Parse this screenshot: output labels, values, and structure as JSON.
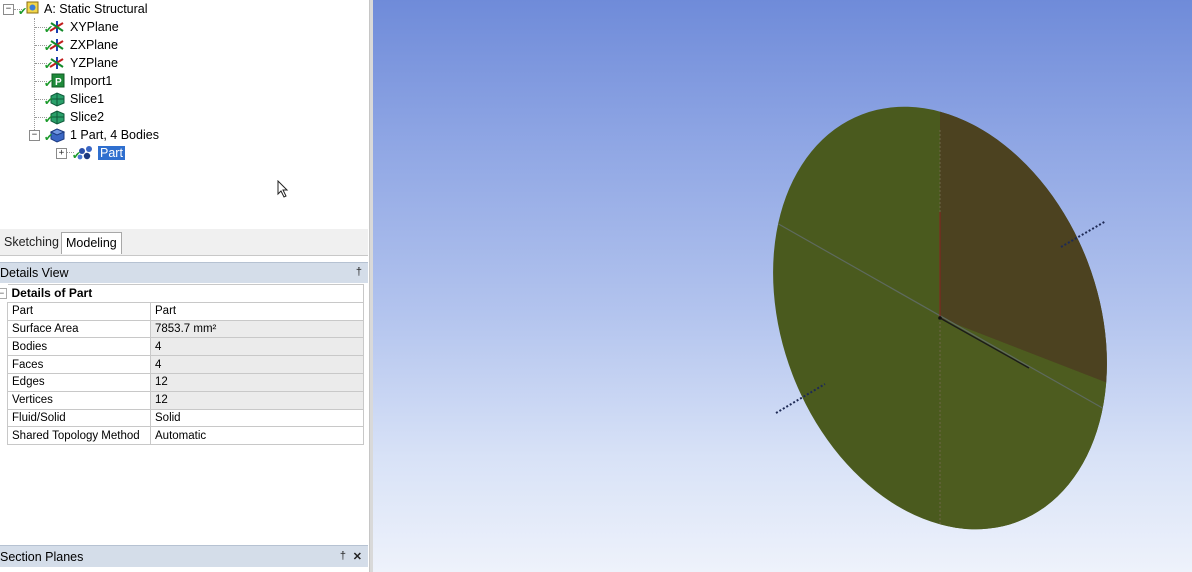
{
  "tree": {
    "root": {
      "label": "A: Static Structural",
      "icon": "static-structural-icon"
    },
    "items": [
      {
        "label": "XYPlane",
        "icon": "plane-axes-icon"
      },
      {
        "label": "ZXPlane",
        "icon": "plane-axes-icon"
      },
      {
        "label": "YZPlane",
        "icon": "plane-axes-icon"
      },
      {
        "label": "Import1",
        "icon": "import-icon"
      },
      {
        "label": "Slice1",
        "icon": "slice-icon"
      },
      {
        "label": "Slice2",
        "icon": "slice-icon"
      },
      {
        "label": "1 Part, 4 Bodies",
        "icon": "parts-bodies-icon"
      }
    ],
    "child": {
      "label": "Part",
      "icon": "multibody-part-icon",
      "selected": true
    }
  },
  "tabs": [
    {
      "label": "Sketching",
      "active": false
    },
    {
      "label": "Modeling",
      "active": true
    }
  ],
  "details_view": {
    "title": "Details View",
    "group": "Details of Part",
    "rows": [
      {
        "key": "Part",
        "value": "Part"
      },
      {
        "key": "Surface Area",
        "value": "7853.7 mm²"
      },
      {
        "key": "Bodies",
        "value": "4"
      },
      {
        "key": "Faces",
        "value": "4"
      },
      {
        "key": "Edges",
        "value": "12"
      },
      {
        "key": "Vertices",
        "value": "12"
      },
      {
        "key": "Fluid/Solid",
        "value": "Solid"
      },
      {
        "key": "Shared Topology Method",
        "value": "Automatic"
      }
    ]
  },
  "section_planes": {
    "title": "Section Planes"
  },
  "glyphs": {
    "pin": "†",
    "close": "✕",
    "collapse": "−",
    "expand": "+"
  },
  "colors": {
    "selection": "#2f6fcf",
    "disk_face": "#4a5a1e",
    "disk_upper_right": "#4c4220",
    "viewport_top": "#6f8bd9",
    "viewport_bottom": "#eef2fb"
  }
}
